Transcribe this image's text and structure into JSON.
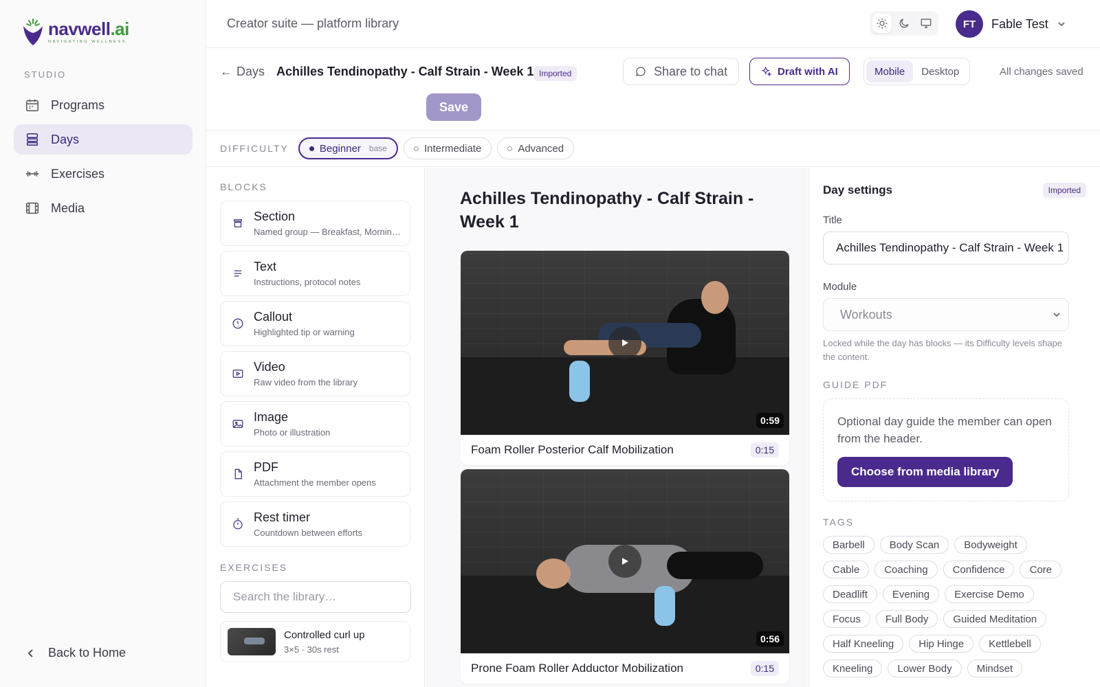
{
  "brand": {
    "logo_word": "navwell",
    "logo_ai": ".ai",
    "tagline": "NAVIGATING WELLNESS"
  },
  "sidebar": {
    "section_label": "STUDIO",
    "items": [
      {
        "label": "Programs",
        "icon": "calendar-icon"
      },
      {
        "label": "Days",
        "icon": "layout-icon",
        "active": true
      },
      {
        "label": "Exercises",
        "icon": "dumbbell-icon"
      },
      {
        "label": "Media",
        "icon": "film-icon"
      }
    ],
    "back_home": "Back to Home"
  },
  "topbar": {
    "breadcrumb": "Creator suite — platform library",
    "user": {
      "initials": "FT",
      "name": "Fable Test"
    }
  },
  "header": {
    "back_label": "Days",
    "title": "Achilles Tendinopathy - Calf Strain - Week 1",
    "badge": "Imported",
    "share_label": "Share to chat",
    "draft_label": "Draft with AI",
    "view_mobile": "Mobile",
    "view_desktop": "Desktop",
    "status": "All changes saved",
    "save_label": "Save"
  },
  "difficulty": {
    "label": "DIFFICULTY",
    "options": [
      {
        "label": "Beginner",
        "note": "base",
        "active": true
      },
      {
        "label": "Intermediate"
      },
      {
        "label": "Advanced"
      }
    ]
  },
  "blocks": {
    "label": "BLOCKS",
    "items": [
      {
        "title": "Section",
        "sub": "Named group — Breakfast, Morning…",
        "icon": "section-icon"
      },
      {
        "title": "Text",
        "sub": "Instructions, protocol notes",
        "icon": "text-icon"
      },
      {
        "title": "Callout",
        "sub": "Highlighted tip or warning",
        "icon": "alert-icon"
      },
      {
        "title": "Video",
        "sub": "Raw video from the library",
        "icon": "video-icon"
      },
      {
        "title": "Image",
        "sub": "Photo or illustration",
        "icon": "image-icon"
      },
      {
        "title": "PDF",
        "sub": "Attachment the member opens",
        "icon": "file-icon"
      },
      {
        "title": "Rest timer",
        "sub": "Countdown between efforts",
        "icon": "timer-icon"
      }
    ]
  },
  "exercises": {
    "label": "EXERCISES",
    "search_placeholder": "Search the library…",
    "items": [
      {
        "title": "Controlled curl up",
        "sub": "3×5 · 30s rest"
      }
    ]
  },
  "preview": {
    "title": "Achilles Tendinopathy - Calf Strain - Week 1",
    "videos": [
      {
        "name": "Foam Roller Posterior Calf Mobilization",
        "duration": "0:59",
        "time": "0:15"
      },
      {
        "name": "Prone Foam Roller Adductor Mobilization",
        "duration": "0:56",
        "time": "0:15"
      }
    ]
  },
  "settings": {
    "title": "Day settings",
    "badge": "Imported",
    "title_label": "Title",
    "title_value": "Achilles Tendinopathy - Calf Strain - Week 1",
    "module_label": "Module",
    "module_value": "Workouts",
    "module_help": "Locked while the day has blocks — its Difficulty levels shape the content.",
    "guide_label": "GUIDE PDF",
    "guide_text": "Optional day guide the member can open from the header.",
    "guide_button": "Choose from media library",
    "tags_label": "TAGS",
    "tags": [
      "Barbell",
      "Body Scan",
      "Bodyweight",
      "Cable",
      "Coaching",
      "Confidence",
      "Core",
      "Deadlift",
      "Evening",
      "Exercise Demo",
      "Focus",
      "Full Body",
      "Guided Meditation",
      "Half Kneeling",
      "Hip Hinge",
      "Kettlebell",
      "Kneeling",
      "Lower Body",
      "Mindset"
    ]
  },
  "colors": {
    "accent": "#4a2a8c",
    "accent_soft": "#efecf7",
    "save_disabled": "#a296c9"
  }
}
